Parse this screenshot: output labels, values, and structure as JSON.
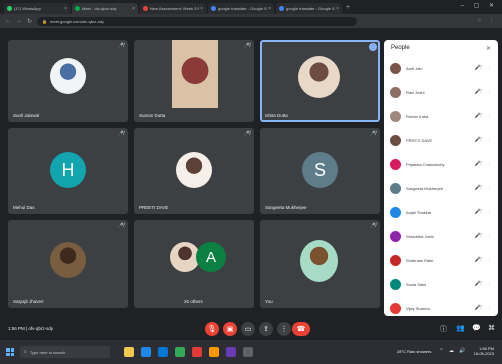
{
  "browser": {
    "tabs": [
      {
        "label": "(17) WhatsApp",
        "favicon": "#25d366"
      },
      {
        "label": "Meet - ofv-qbrz-sdy",
        "favicon": "#00ac47"
      },
      {
        "label": "New Assessment: Week 3 Revie",
        "favicon": "#ea4335"
      },
      {
        "label": "google translate - Google Search",
        "favicon": "#4285f4"
      },
      {
        "label": "google translate - Google Search",
        "favicon": "#4285f4"
      }
    ],
    "url": "meet.google.com/ofv-qbrz-sdy"
  },
  "meet": {
    "tiles": [
      {
        "name": "Sunil Jaiswal",
        "kind": "photo",
        "colors": [
          "#f1f3f4",
          "#4a6fa5"
        ]
      },
      {
        "name": "Suman Dutta",
        "kind": "video",
        "colors": [
          "#d9c2a6",
          "#8b3a3a"
        ]
      },
      {
        "name": "Ishita Dutta",
        "kind": "photo-self",
        "colors": [
          "#e7d8c8",
          "#6d4c41"
        ]
      },
      {
        "name": "Mehul Das",
        "kind": "letter",
        "letter": "H",
        "color": "#12a4af"
      },
      {
        "name": "PREETI DAVE",
        "kind": "photo",
        "colors": [
          "#f6efe9",
          "#5d4037"
        ]
      },
      {
        "name": "Sangeeta Mukherjee",
        "kind": "letter",
        "letter": "S",
        "color": "#5f7c8a"
      },
      {
        "name": "Satyajit Jhaveri",
        "kind": "photo",
        "colors": [
          "#7a5c3e",
          "#3e2a1c"
        ]
      },
      {
        "name": "26 others",
        "kind": "others",
        "letter": "A",
        "color": "#0b8043",
        "colors": [
          "#e6d5c3",
          "#4e342e"
        ]
      },
      {
        "name": "You",
        "kind": "photo",
        "colors": [
          "#a6dcc7",
          "#7a5230"
        ]
      }
    ]
  },
  "people": {
    "title": "People",
    "list": [
      {
        "name": "Amit Jain",
        "color": "#795548"
      },
      {
        "name": "Ravi Joshi",
        "color": "#8d6e63"
      },
      {
        "name": "Rohan Kalra",
        "color": "#a1887f"
      },
      {
        "name": "PREETI DAVE",
        "color": "#6d4c41"
      },
      {
        "name": "Priyanka Chakraborty",
        "color": "#d81b60"
      },
      {
        "name": "Sangeeta Mukherjee",
        "color": "#5f7c8a"
      },
      {
        "name": "Anjali Thakkar",
        "color": "#1e88e5"
      },
      {
        "name": "Shraddha Joshi",
        "color": "#8e24aa"
      },
      {
        "name": "Shabnam Patel",
        "color": "#c62828"
      },
      {
        "name": "Sonia Saini",
        "color": "#00897b"
      },
      {
        "name": "Vijay Sharma",
        "color": "#e53935"
      }
    ]
  },
  "controls": {
    "time_code": "1:56 PM | ofv-qbrz-sdy"
  },
  "taskbar": {
    "search_placeholder": "Type here to search",
    "apps": [
      "#f2c94c",
      "#1e88e5",
      "#0078d4",
      "#34a853",
      "#e53935",
      "#ff9800",
      "#673ab7",
      "#5f6368"
    ],
    "weather": "28°C Rain showers",
    "time": "1:56 PM",
    "date": "18-05-2023"
  }
}
